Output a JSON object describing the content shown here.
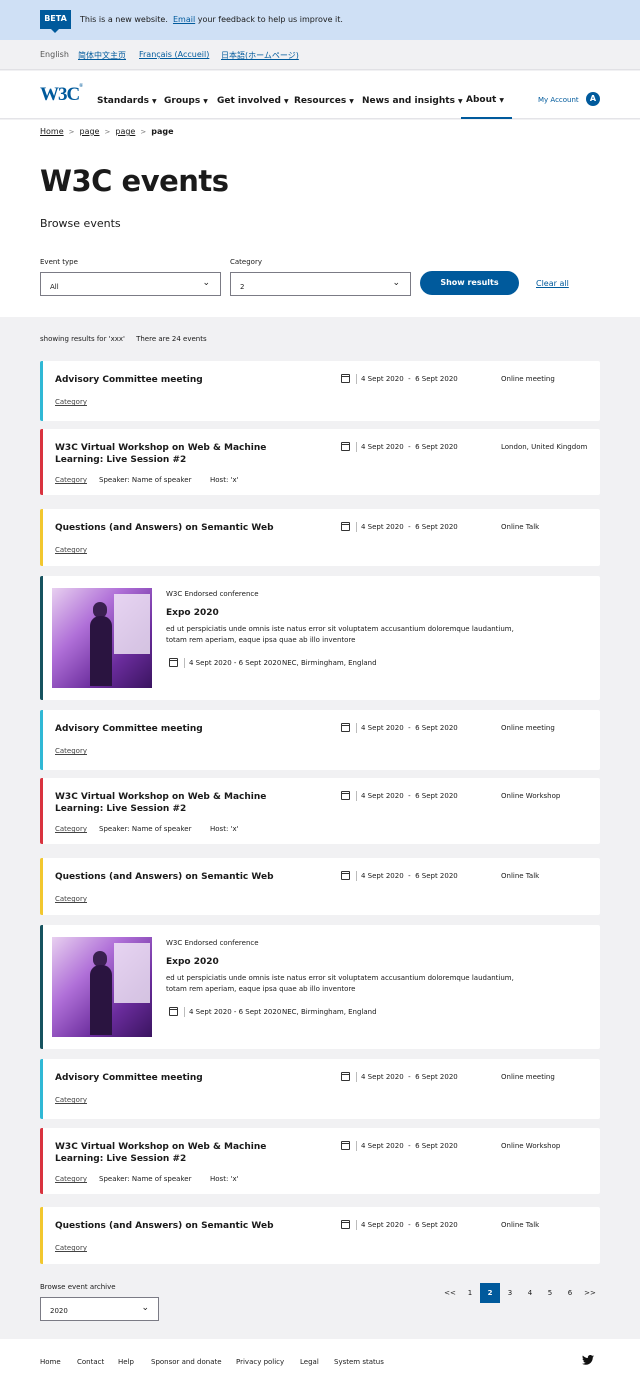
{
  "beta": {
    "badge": "BETA",
    "text_before": "This is a new website.",
    "link": "Email",
    "text_after": "your feedback to help us improve it."
  },
  "languages": {
    "current": "English",
    "links": [
      "简体中文主页",
      "Français (Accueil)",
      "日本語(ホームページ)"
    ]
  },
  "header": {
    "logo": "W3C",
    "logo_mark": "®",
    "nav": [
      "Standards",
      "Groups",
      "Get involved",
      "Resources",
      "News and insights",
      "About"
    ],
    "active_nav": "About",
    "account_label": "My Account",
    "avatar_letter": "A"
  },
  "breadcrumb": [
    "Home",
    "page",
    "page",
    "page"
  ],
  "page_title": "W3C events",
  "subtitle": "Browse events",
  "filters": {
    "event_type_label": "Event type",
    "event_type_value": "All",
    "category_label": "Category",
    "category_value": "2",
    "show_results": "Show results",
    "clear_all": "Clear all"
  },
  "results": {
    "showing": "showing results for 'xxx'",
    "count_text": "There are 24 events"
  },
  "events": [
    {
      "type": "standard",
      "color": "#30b8d5",
      "title": "Advisory Committee meeting",
      "category": "Category",
      "date_start": "4 Sept 2020",
      "date_end": "6 Sept 2020",
      "location": "Online meeting"
    },
    {
      "type": "standard",
      "color": "#d9333f",
      "title": "W3C Virtual Workshop on Web & Machine Learning: Live Session #2",
      "category": "Category",
      "speaker": "Speaker: Name of speaker",
      "host": "Host: 'x'",
      "date_start": "4 Sept 2020",
      "date_end": "6 Sept 2020",
      "location": "London, United Kingdom"
    },
    {
      "type": "standard",
      "color": "#f2c72e",
      "title": "Questions (and Answers) on Semantic Web",
      "category": "Category",
      "date_start": "4 Sept 2020",
      "date_end": "6 Sept 2020",
      "location": "Online Talk"
    },
    {
      "type": "featured",
      "color": "#16535f",
      "kicker": "W3C Endorsed conference",
      "title": "Expo 2020",
      "description": "ed ut perspiciatis unde omnis iste natus error sit voluptatem accusantium doloremque laudantium, totam rem aperiam, eaque ipsa quae ab illo inventore",
      "dates": "4 Sept 2020 - 6 Sept 2020",
      "location": "NEC, Birmingham, England"
    },
    {
      "type": "standard",
      "color": "#30b8d5",
      "title": "Advisory Committee meeting",
      "category": "Category",
      "date_start": "4 Sept 2020",
      "date_end": "6 Sept 2020",
      "location": "Online meeting"
    },
    {
      "type": "standard",
      "color": "#d9333f",
      "title": "W3C Virtual Workshop on Web & Machine Learning: Live Session #2",
      "category": "Category",
      "speaker": "Speaker: Name of speaker",
      "host": "Host: 'x'",
      "date_start": "4 Sept 2020",
      "date_end": "6 Sept 2020",
      "location": "Online Workshop"
    },
    {
      "type": "standard",
      "color": "#f2c72e",
      "title": "Questions (and Answers) on Semantic Web",
      "category": "Category",
      "date_start": "4 Sept 2020",
      "date_end": "6 Sept 2020",
      "location": "Online Talk"
    },
    {
      "type": "featured",
      "color": "#16535f",
      "kicker": "W3C Endorsed conference",
      "title": "Expo 2020",
      "description": "ed ut perspiciatis unde omnis iste natus error sit voluptatem accusantium doloremque laudantium, totam rem aperiam, eaque ipsa quae ab illo inventore",
      "dates": "4 Sept 2020 - 6 Sept 2020",
      "location": "NEC, Birmingham, England"
    },
    {
      "type": "standard",
      "color": "#30b8d5",
      "title": "Advisory Committee meeting",
      "category": "Category",
      "date_start": "4 Sept 2020",
      "date_end": "6 Sept 2020",
      "location": "Online meeting"
    },
    {
      "type": "standard",
      "color": "#d9333f",
      "title": "W3C Virtual Workshop on Web & Machine Learning: Live Session #2",
      "category": "Category",
      "speaker": "Speaker: Name of speaker",
      "host": "Host: 'x'",
      "date_start": "4 Sept 2020",
      "date_end": "6 Sept 2020",
      "location": "Online Workshop"
    },
    {
      "type": "standard",
      "color": "#f2c72e",
      "title": "Questions (and Answers) on Semantic Web",
      "category": "Category",
      "date_start": "4 Sept 2020",
      "date_end": "6 Sept 2020",
      "location": "Online Talk"
    }
  ],
  "archive": {
    "label": "Browse event archive",
    "value": "2020"
  },
  "pagination": {
    "first": "<<",
    "pages": [
      "1",
      "2",
      "3",
      "4",
      "5",
      "6"
    ],
    "current": "2",
    "last": ">>"
  },
  "footer": {
    "links": [
      "Home",
      "Contact",
      "Help",
      "Sponsor and donate",
      "Privacy policy",
      "Legal",
      "System status"
    ],
    "social_icon": "twitter-icon"
  }
}
